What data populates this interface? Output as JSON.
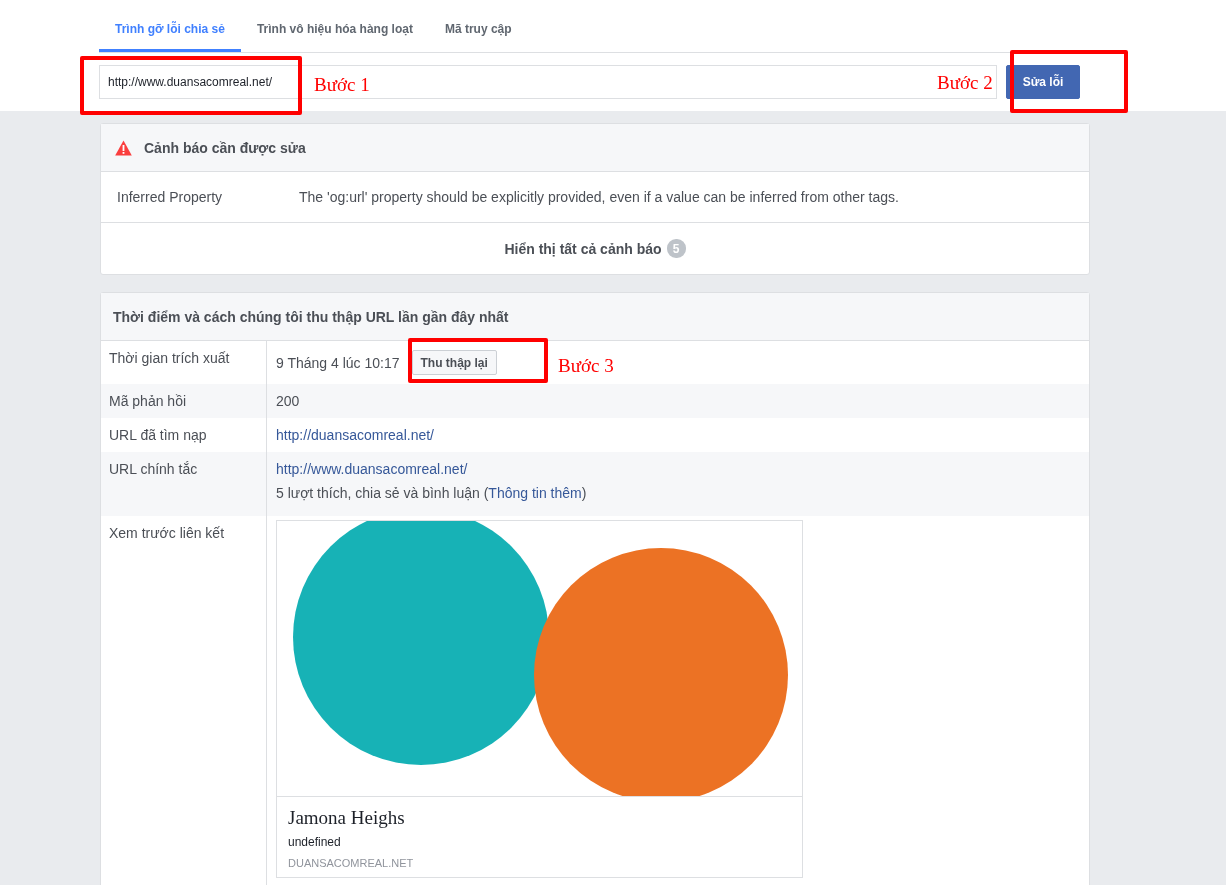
{
  "tabs": [
    {
      "label": "Trình gỡ lỗi chia sẻ",
      "selected": true
    },
    {
      "label": "Trình vô hiệu hóa hàng loạt",
      "selected": false
    },
    {
      "label": "Mã truy cập",
      "selected": false
    }
  ],
  "url_field": {
    "value": "http://www.duansacomreal.net/"
  },
  "fix_button": "Sửa lỗi",
  "warnings": {
    "title": "Cảnh báo cần được sửa",
    "rows": [
      {
        "property": "Inferred Property",
        "message": "The 'og:url' property should be explicitly provided, even if a value can be inferred from other tags."
      }
    ],
    "show_all": "Hiển thị tất cả cảnh báo",
    "count": "5"
  },
  "scrape": {
    "title": "Thời điểm và cách chúng tôi thu thập URL lần gần đây nhất",
    "rows": [
      {
        "kind": "time",
        "label": "Thời gian trích xuất",
        "value": "9 Tháng 4 lúc 10:17",
        "button": "Thu thập lại"
      },
      {
        "kind": "text",
        "label": "Mã phản hồi",
        "value": "200"
      },
      {
        "kind": "link",
        "label": "URL đã tìm nạp",
        "value": "http://duansacomreal.net/"
      },
      {
        "kind": "canonical",
        "label": "URL chính tắc",
        "value": "http://www.duansacomreal.net/",
        "note": "5 lượt thích, chia sẻ và bình luận (",
        "note_link": "Thông tin thêm",
        "note_end": ")"
      },
      {
        "kind": "preview",
        "label": "Xem trước liên kết",
        "title": "Jamona Heighs",
        "description": "undefined",
        "domain": "DUANSACOMREAL.NET"
      }
    ]
  },
  "annotations": [
    {
      "label": "Bước 1"
    },
    {
      "label": "Bước 2"
    },
    {
      "label": "Bước 3"
    }
  ]
}
